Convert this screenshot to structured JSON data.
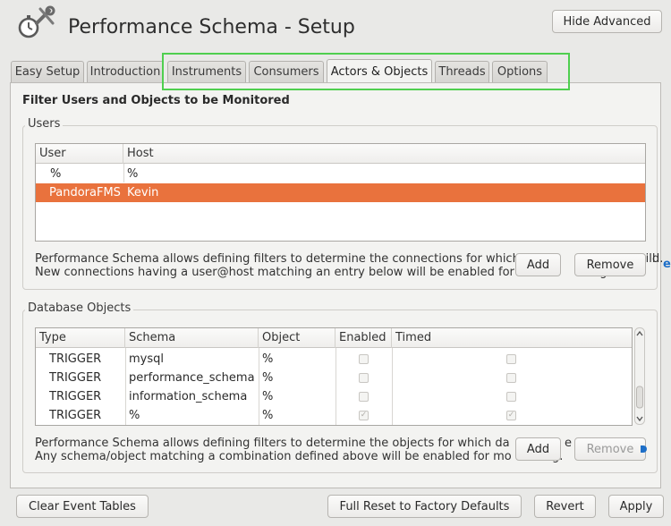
{
  "window": {
    "title": "Performance Schema - Setup",
    "hide_advanced_label": "Hide Advanced"
  },
  "tabs": [
    {
      "label": "Easy Setup",
      "active": false
    },
    {
      "label": "Introduction",
      "active": false
    },
    {
      "label": "Instruments",
      "active": false
    },
    {
      "label": "Consumers",
      "active": false
    },
    {
      "label": "Actors & Objects",
      "active": true
    },
    {
      "label": "Threads",
      "active": false
    },
    {
      "label": "Options",
      "active": false
    }
  ],
  "page": {
    "heading": "Filter Users and Objects to be Monitored"
  },
  "users": {
    "group_label": "Users",
    "columns": [
      "User",
      "Host"
    ],
    "rows": [
      {
        "user": "%",
        "host": "%",
        "selected": false
      },
      {
        "user": "PandoraFMS",
        "host": "Kevin",
        "selected": true
      }
    ],
    "description_line1": "Performance Schema allows defining filters to determine the connections for which",
    "description_line1_tail": "will",
    "description_line1_end": "d.",
    "description_line2": "New connections having a user@host matching an entry below will be enabled for",
    "description_line2_tail": "ring",
    "add_label": "Add",
    "remove_label": "Remove"
  },
  "database_objects": {
    "group_label": "Database Objects",
    "columns": [
      "Type",
      "Schema",
      "Object",
      "Enabled",
      "Timed"
    ],
    "rows": [
      {
        "type": "TRIGGER",
        "schema": "mysql",
        "object": "%",
        "enabled": false,
        "timed": false
      },
      {
        "type": "TRIGGER",
        "schema": "performance_schema",
        "object": "%",
        "enabled": false,
        "timed": false
      },
      {
        "type": "TRIGGER",
        "schema": "information_schema",
        "object": "%",
        "enabled": false,
        "timed": false
      },
      {
        "type": "TRIGGER",
        "schema": "%",
        "object": "%",
        "enabled": true,
        "timed": true
      }
    ],
    "description_line1": "Performance Schema allows defining filters to determine the objects for which da",
    "description_line1_tail": "e c",
    "description_line2": "Any schema/object matching a combination defined above will be enabled for mo",
    "description_line2_tail": "g.",
    "add_label": "Add",
    "remove_label": "Remove"
  },
  "footer": {
    "clear_label": "Clear Event Tables",
    "reset_label": "Full Reset to Factory Defaults",
    "revert_label": "Revert",
    "apply_label": "Apply"
  },
  "colors": {
    "selection": "#e9723d",
    "highlight_box": "#4fcf4f",
    "info_icon": "#1e6fc8"
  }
}
